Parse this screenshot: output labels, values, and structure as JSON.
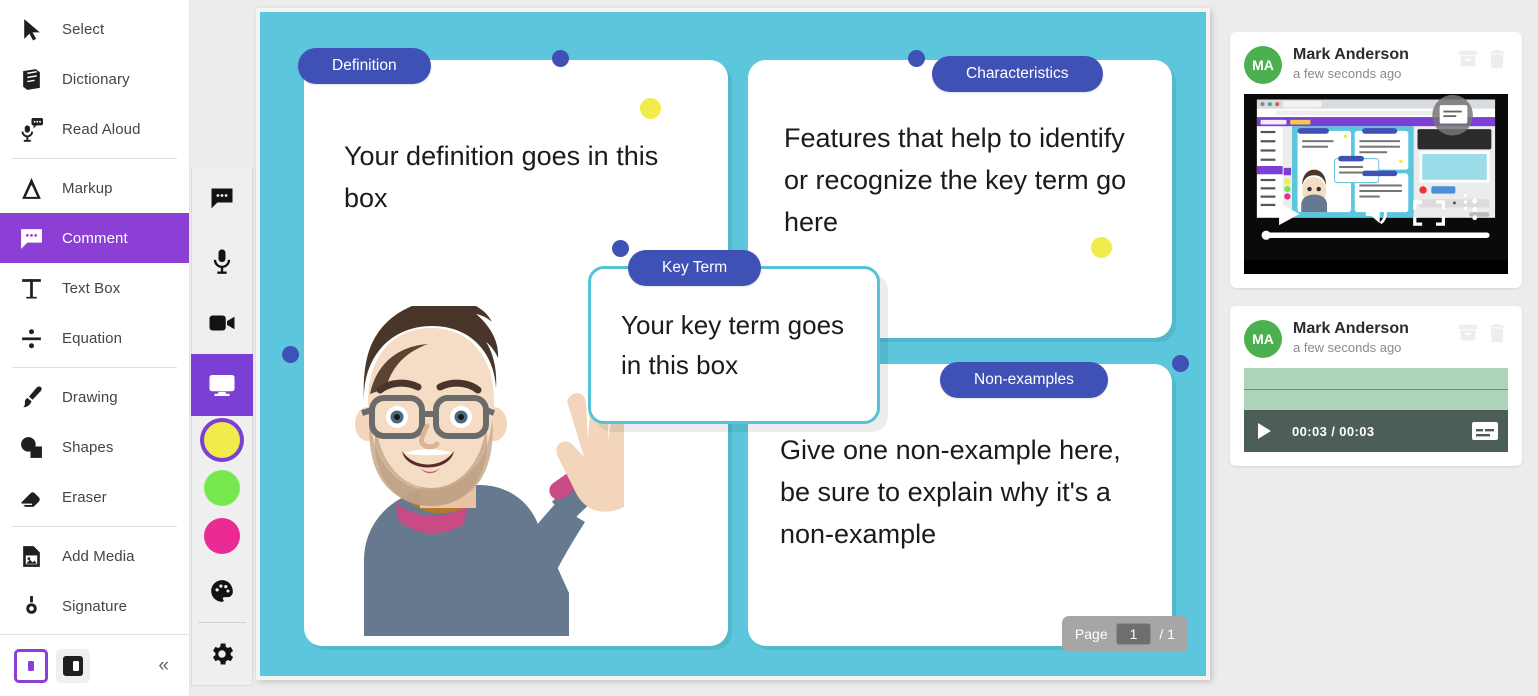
{
  "sidebar": {
    "items": [
      {
        "label": "Select",
        "icon": "cursor-icon",
        "active": false,
        "sep_after": false
      },
      {
        "label": "Dictionary",
        "icon": "book-icon",
        "active": false,
        "sep_after": false
      },
      {
        "label": "Read Aloud",
        "icon": "mic-speech-icon",
        "active": false,
        "sep_after": true
      },
      {
        "label": "Markup",
        "icon": "markup-icon",
        "active": false,
        "sep_after": false
      },
      {
        "label": "Comment",
        "icon": "comment-icon",
        "active": true,
        "sep_after": false
      },
      {
        "label": "Text Box",
        "icon": "text-icon",
        "active": false,
        "sep_after": false
      },
      {
        "label": "Equation",
        "icon": "divide-icon",
        "active": false,
        "sep_after": true
      },
      {
        "label": "Drawing",
        "icon": "brush-icon",
        "active": false,
        "sep_after": false
      },
      {
        "label": "Shapes",
        "icon": "shapes-icon",
        "active": false,
        "sep_after": false
      },
      {
        "label": "Eraser",
        "icon": "eraser-icon",
        "active": false,
        "sep_after": true
      },
      {
        "label": "Add Media",
        "icon": "add-media-icon",
        "active": false,
        "sep_after": false
      },
      {
        "label": "Signature",
        "icon": "signature-icon",
        "active": false,
        "sep_after": false
      }
    ],
    "footer": {
      "layout_single_icon": "layout-single-icon",
      "layout_split_icon": "layout-split-icon",
      "collapse_label": "«"
    },
    "accent_color": "#8B3FD4"
  },
  "mini_toolbar": {
    "buttons": [
      {
        "name": "text-comment",
        "icon": "comment-bubble-icon",
        "active": false
      },
      {
        "name": "audio-comment",
        "icon": "microphone-icon",
        "active": false
      },
      {
        "name": "video-comment",
        "icon": "video-camera-icon",
        "active": false
      },
      {
        "name": "screen-comment",
        "icon": "monitor-icon",
        "active": true
      }
    ],
    "swatches": [
      {
        "name": "yellow",
        "color": "#F2EB4C",
        "selected": true
      },
      {
        "name": "green",
        "color": "#78E84F",
        "selected": false
      },
      {
        "name": "pink",
        "color": "#EC2A93",
        "selected": false
      }
    ],
    "palette_icon": "palette-icon",
    "settings_icon": "gear-icon"
  },
  "canvas": {
    "background_color": "#5BC6DC",
    "cards": [
      {
        "id": "definition",
        "chip": "Definition",
        "text": "Your definition goes in this box"
      },
      {
        "id": "characteristics",
        "chip": "Characteristics",
        "text": "Features that help to identify or recognize the key term go here"
      },
      {
        "id": "key_term",
        "chip": "Key Term",
        "text": "Your key term goes in this box"
      },
      {
        "id": "non_examples",
        "chip": "Non-examples",
        "text": "Give one non-example here, be sure to explain why it's a non-example"
      }
    ],
    "chip_color": "#3F51B5",
    "handle_color": "#3F51B5",
    "sticky_dot_color": "#F2EB4C",
    "avatar_art": "waving-memoji-illustration"
  },
  "page_indicator": {
    "label": "Page",
    "current": "1",
    "total": "/ 1"
  },
  "comments_panel": {
    "cards": [
      {
        "initials": "MA",
        "author": "Mark Anderson",
        "time": "a few seconds ago",
        "type": "video",
        "archive_icon": "archive-icon",
        "delete_icon": "trash-icon",
        "play_icon": "play-icon",
        "volume_icon": "volume-icon",
        "fullscreen_icon": "fullscreen-icon",
        "more_icon": "more-vertical-icon"
      },
      {
        "initials": "MA",
        "author": "Mark Anderson",
        "time": "a few seconds ago",
        "type": "audio",
        "archive_icon": "archive-icon",
        "delete_icon": "trash-icon",
        "play_icon": "play-icon",
        "time_display": "00:03 / 00:03",
        "captions_icon": "captions-icon"
      }
    ]
  }
}
